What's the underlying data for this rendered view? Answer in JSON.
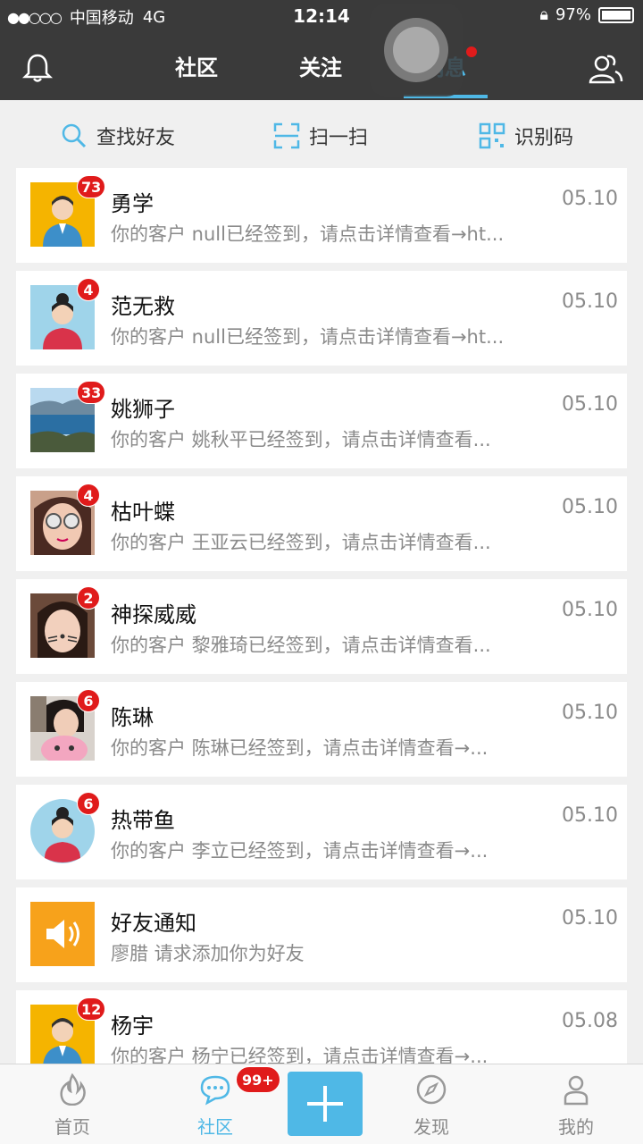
{
  "status_bar": {
    "signal": "●●○○○",
    "carrier": "中国移动",
    "network": "4G",
    "time": "12:14",
    "battery": "97%"
  },
  "header": {
    "tabs": [
      {
        "label": "社区"
      },
      {
        "label": "关注"
      },
      {
        "label": "消息"
      }
    ]
  },
  "tools": {
    "find_friends": "查找好友",
    "scan": "扫一扫",
    "qr_code": "识别码"
  },
  "messages": [
    {
      "name": "勇学",
      "badge": "73",
      "preview": "你的客户 null已经签到，请点击详情查看→ht...",
      "date": "05.10"
    },
    {
      "name": "范无救",
      "badge": "4",
      "preview": "你的客户 null已经签到，请点击详情查看→ht...",
      "date": "05.10"
    },
    {
      "name": "姚狮子",
      "badge": "33",
      "preview": "你的客户 姚秋平已经签到，请点击详情查看...",
      "date": "05.10"
    },
    {
      "name": "枯叶蝶",
      "badge": "4",
      "preview": "你的客户 王亚云已经签到，请点击详情查看...",
      "date": "05.10"
    },
    {
      "name": "神探威威",
      "badge": "2",
      "preview": "你的客户 黎雅琦已经签到，请点击详情查看...",
      "date": "05.10"
    },
    {
      "name": "陈琳",
      "badge": "6",
      "preview": "你的客户 陈琳已经签到，请点击详情查看→...",
      "date": "05.10"
    },
    {
      "name": "热带鱼",
      "badge": "6",
      "preview": "你的客户 李立已经签到，请点击详情查看→...",
      "date": "05.10"
    },
    {
      "name": "好友通知",
      "badge": "",
      "preview": "廖腊 请求添加你为好友",
      "date": "05.10"
    },
    {
      "name": "杨宇",
      "badge": "12",
      "preview": "你的客户 杨宁已经签到，请点击详情查看→...",
      "date": "05.08"
    }
  ],
  "tabbar": {
    "home": "首页",
    "community": "社区",
    "community_badge": "99+",
    "discover": "发现",
    "mine": "我的"
  }
}
